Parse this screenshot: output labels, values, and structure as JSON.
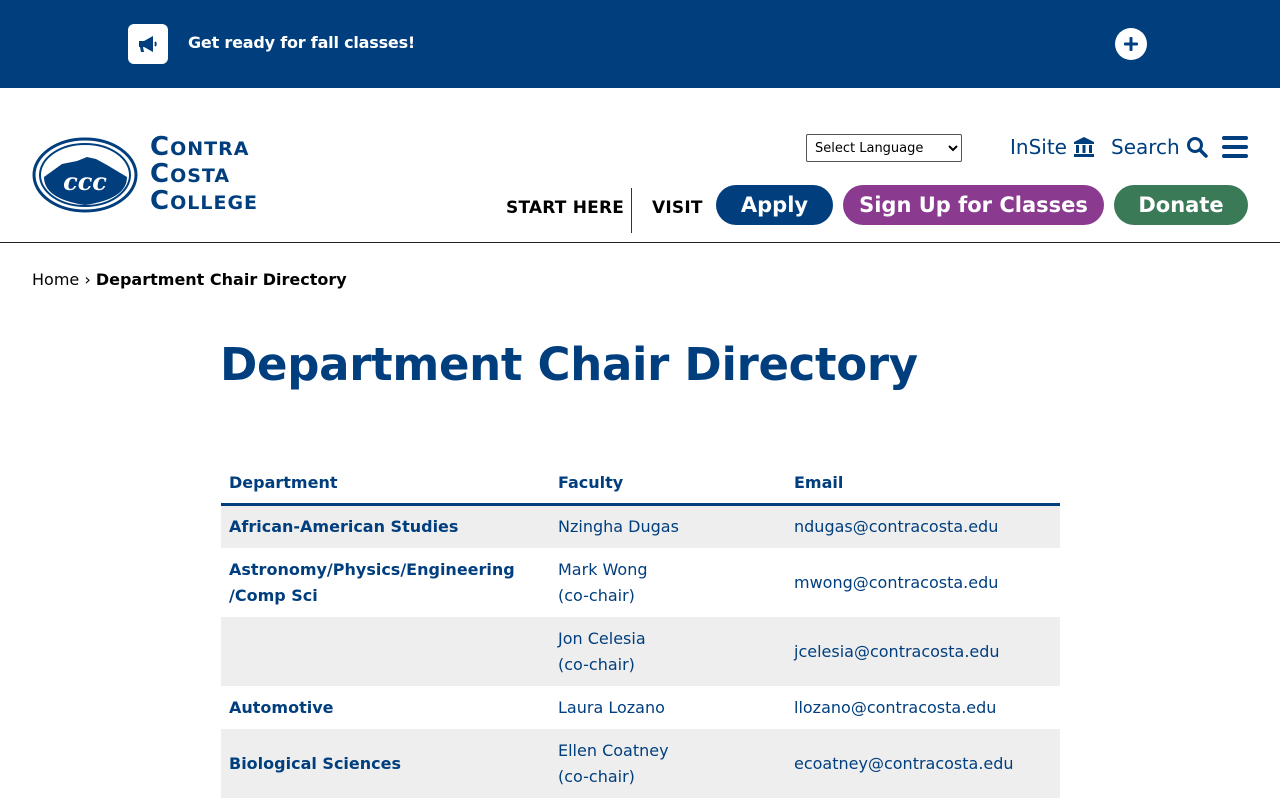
{
  "alert": {
    "icon": "megaphone-icon",
    "text": "Get ready for fall classes!",
    "toggle_icon": "plus-icon"
  },
  "header": {
    "logo": {
      "line1": "Contra",
      "line2": "Costa",
      "line3": "College"
    },
    "language_select": {
      "selected": "Select Language"
    },
    "insite_label": "InSite",
    "search_label": "Search",
    "nav": {
      "start_here": "START HERE",
      "visit": "VISIT"
    },
    "buttons": {
      "apply": "Apply",
      "signup": "Sign Up for Classes",
      "donate": "Donate"
    }
  },
  "breadcrumb": {
    "home": "Home",
    "separator": "›",
    "current": "Department Chair Directory"
  },
  "page_title": "Department Chair Directory",
  "table": {
    "headers": {
      "department": "Department",
      "faculty": "Faculty",
      "email": "Email"
    },
    "rows": [
      {
        "department": "African-American Studies",
        "faculty": "Nzingha Dugas",
        "note": "",
        "email": "ndugas@contracosta.edu"
      },
      {
        "department": "Astronomy/Physics/Engineering /Comp Sci",
        "faculty": "Mark Wong",
        "note": "(co-chair)",
        "email": "mwong@contracosta.edu"
      },
      {
        "department": "",
        "faculty": "Jon Celesia",
        "note": "(co-chair)",
        "email": "jcelesia@contracosta.edu"
      },
      {
        "department": "Automotive",
        "faculty": "Laura Lozano",
        "note": "",
        "email": "llozano@contracosta.edu"
      },
      {
        "department": "Biological Sciences",
        "faculty": "Ellen Coatney",
        "note": "(co-chair)",
        "email": "ecoatney@contracosta.edu"
      }
    ]
  },
  "colors": {
    "brand_blue": "#003e7e",
    "signup_purple": "#8a3a8f",
    "donate_green": "#3b7a57",
    "row_shade": "#eeeeee"
  }
}
